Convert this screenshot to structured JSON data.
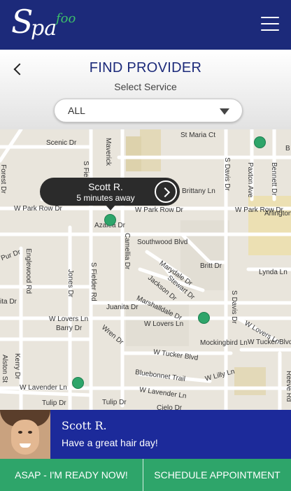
{
  "app": {
    "logo_main_s": "S",
    "logo_main_pa": "pa",
    "logo_accent": "foo"
  },
  "header": {
    "menu_icon": "hamburger-icon"
  },
  "panel": {
    "title": "FIND PROVIDER",
    "subtitle": "Select Service",
    "service_select": {
      "value": "ALL"
    }
  },
  "map": {
    "streets": [
      "Scenic Dr",
      "Maverick",
      "St Maria Ct",
      "S Fielder",
      "Brittany Ln",
      "S Davis Dr",
      "Paxton Ave",
      "Bennett Dr",
      "Forest Dr",
      "W Park Row Dr",
      "W Park Row Dr",
      "W Park Row Dr",
      "Azalea Dr",
      "Camellia Dr",
      "Arlington",
      "Southwood Blvd",
      "Pur Dr",
      "Englewood Rd",
      "Jones Dr",
      "S Fielder Rd",
      "Marydale Dr",
      "Britt Dr",
      "Lynda Ln",
      "Jackson Dr",
      "Stewart Dr",
      "Marshalldale Dr",
      "Juanita Dr",
      "S Davis Dr",
      "ita Dr",
      "W Lovers Ln",
      "W Lovers Ln",
      "W Lovers Ln",
      "Barry Dr",
      "Wren Dr",
      "Mockingbird Ln",
      "W Tucker Blvd",
      "W Tucker Blvd",
      "Kerry Dr",
      "Alston St",
      "Bluebonnet Trail",
      "W Lilly Ln",
      "W Lavender Ln",
      "W Lavender Ln",
      "Tulip Dr",
      "Tulip Dr",
      "Reeve Rd",
      "B",
      "Cielo Dr"
    ],
    "callout": {
      "name": "Scott R.",
      "eta": "5 minutes away"
    }
  },
  "provider_card": {
    "name": "Scott R.",
    "message": "Have a great hair day!"
  },
  "actions": {
    "asap_label": "ASAP - I'M READY NOW!",
    "schedule_label": "SCHEDULE APPOINTMENT"
  },
  "colors": {
    "navy": "#1c2a7a",
    "green": "#2ea56a",
    "card": "#1c2a9a"
  }
}
